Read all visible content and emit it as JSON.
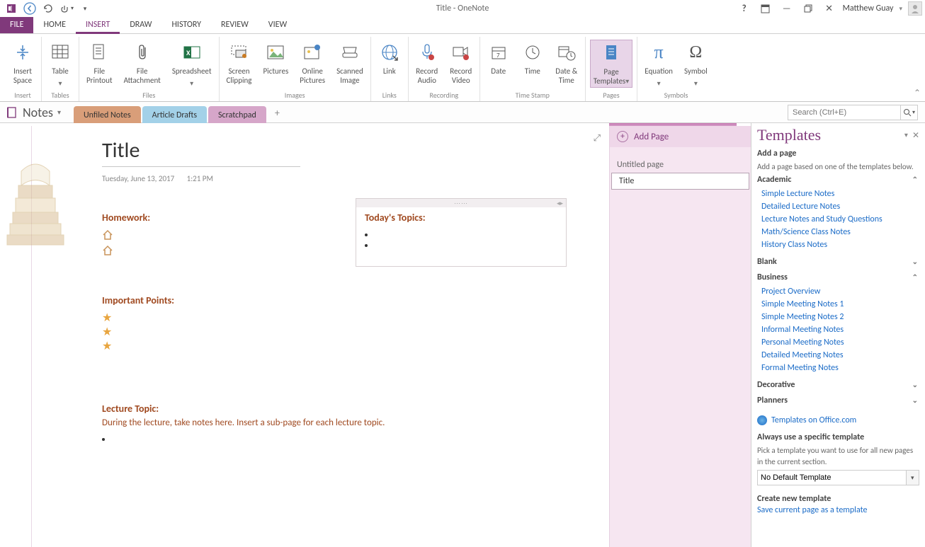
{
  "titlebar": {
    "title": "Title - OneNote"
  },
  "user": {
    "name": "Matthew Guay"
  },
  "ribbonTabs": {
    "file": "FILE",
    "home": "HOME",
    "insert": "INSERT",
    "draw": "DRAW",
    "history": "HISTORY",
    "review": "REVIEW",
    "view": "VIEW"
  },
  "ribbon": {
    "insertSpace": "Insert\nSpace",
    "table": "Table",
    "filePrintout": "File\nPrintout",
    "fileAttachment": "File\nAttachment",
    "spreadsheet": "Spreadsheet",
    "screenClipping": "Screen\nClipping",
    "pictures": "Pictures",
    "onlinePictures": "Online\nPictures",
    "scannedImage": "Scanned\nImage",
    "link": "Link",
    "recordAudio": "Record\nAudio",
    "recordVideo": "Record\nVideo",
    "date": "Date",
    "time": "Time",
    "dateTime": "Date &\nTime",
    "pageTemplates": "Page\nTemplates",
    "equation": "Equation",
    "symbol": "Symbol",
    "groups": {
      "insert": "Insert",
      "tables": "Tables",
      "files": "Files",
      "images": "Images",
      "links": "Links",
      "recording": "Recording",
      "timestamp": "Time Stamp",
      "pages": "Pages",
      "symbols": "Symbols"
    }
  },
  "notebook": {
    "name": "Notes"
  },
  "sections": {
    "t1": "Unfiled Notes",
    "t2": "Article Drafts",
    "t3": "Scratchpad"
  },
  "search": {
    "placeholder": "Search (Ctrl+E)"
  },
  "pagelist": {
    "add": "Add Page",
    "p1": "Untitled page",
    "p2": "Title"
  },
  "page": {
    "title": "Title",
    "date": "Tuesday, June 13, 2017",
    "time": "1:21 PM",
    "homework": "Homework:",
    "topicsHead": "Today's Topics:",
    "importantPoints": "Important Points:",
    "lectureTopic": "Lecture Topic:",
    "lectureBody": "During the lecture, take notes here.  Insert a sub-page for each lecture topic."
  },
  "panel": {
    "title": "Templates",
    "addPage": "Add a page",
    "addPageSub": "Add a page based on one of the templates below.",
    "cats": {
      "academic": "Academic",
      "blank": "Blank",
      "business": "Business",
      "decorative": "Decorative",
      "planners": "Planners"
    },
    "academic": {
      "i0": "Simple Lecture Notes",
      "i1": "Detailed Lecture Notes",
      "i2": "Lecture Notes and Study Questions",
      "i3": "Math/Science Class Notes",
      "i4": "History Class Notes"
    },
    "business": {
      "i0": "Project Overview",
      "i1": "Simple Meeting Notes 1",
      "i2": "Simple Meeting Notes 2",
      "i3": "Informal Meeting Notes",
      "i4": "Personal Meeting Notes",
      "i5": "Detailed Meeting Notes",
      "i6": "Formal Meeting Notes"
    },
    "officeLink": "Templates on Office.com",
    "alwaysHead": "Always use a specific template",
    "alwaysSub": "Pick a template you want to use for all new pages in the current section.",
    "noDefault": "No Default Template",
    "createHead": "Create new template",
    "saveCurrent": "Save current page as a template"
  }
}
